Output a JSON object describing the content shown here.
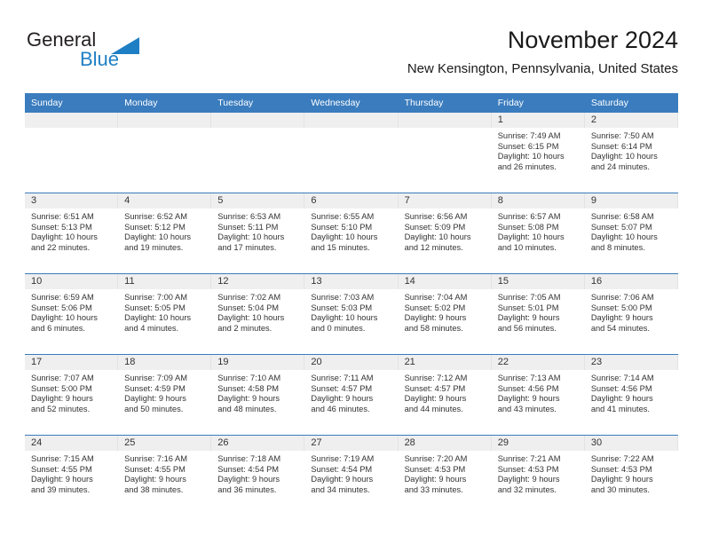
{
  "brand": {
    "name_top": "General",
    "name_bottom": "Blue",
    "triangle_color": "#1f7fc4",
    "text_color": "#231f20",
    "blue_color": "#1f7fc4"
  },
  "header": {
    "title": "November 2024",
    "subtitle": "New Kensington, Pennsylvania, United States"
  },
  "theme": {
    "header_blue": "#3a7cbe",
    "daynum_band": "#efefef",
    "text": "#333333"
  },
  "weekdays": [
    "Sunday",
    "Monday",
    "Tuesday",
    "Wednesday",
    "Thursday",
    "Friday",
    "Saturday"
  ],
  "labels": {
    "sunrise_prefix": "Sunrise:",
    "sunset_prefix": "Sunset:",
    "daylight_prefix": "Daylight:"
  },
  "weeks": [
    [
      {
        "day": "",
        "empty": true
      },
      {
        "day": "",
        "empty": true
      },
      {
        "day": "",
        "empty": true
      },
      {
        "day": "",
        "empty": true
      },
      {
        "day": "",
        "empty": true
      },
      {
        "day": "1",
        "sunrise": "Sunrise: 7:49 AM",
        "sunset": "Sunset: 6:15 PM",
        "daylight_line1": "Daylight: 10 hours",
        "daylight_line2": "and 26 minutes."
      },
      {
        "day": "2",
        "sunrise": "Sunrise: 7:50 AM",
        "sunset": "Sunset: 6:14 PM",
        "daylight_line1": "Daylight: 10 hours",
        "daylight_line2": "and 24 minutes."
      }
    ],
    [
      {
        "day": "3",
        "sunrise": "Sunrise: 6:51 AM",
        "sunset": "Sunset: 5:13 PM",
        "daylight_line1": "Daylight: 10 hours",
        "daylight_line2": "and 22 minutes."
      },
      {
        "day": "4",
        "sunrise": "Sunrise: 6:52 AM",
        "sunset": "Sunset: 5:12 PM",
        "daylight_line1": "Daylight: 10 hours",
        "daylight_line2": "and 19 minutes."
      },
      {
        "day": "5",
        "sunrise": "Sunrise: 6:53 AM",
        "sunset": "Sunset: 5:11 PM",
        "daylight_line1": "Daylight: 10 hours",
        "daylight_line2": "and 17 minutes."
      },
      {
        "day": "6",
        "sunrise": "Sunrise: 6:55 AM",
        "sunset": "Sunset: 5:10 PM",
        "daylight_line1": "Daylight: 10 hours",
        "daylight_line2": "and 15 minutes."
      },
      {
        "day": "7",
        "sunrise": "Sunrise: 6:56 AM",
        "sunset": "Sunset: 5:09 PM",
        "daylight_line1": "Daylight: 10 hours",
        "daylight_line2": "and 12 minutes."
      },
      {
        "day": "8",
        "sunrise": "Sunrise: 6:57 AM",
        "sunset": "Sunset: 5:08 PM",
        "daylight_line1": "Daylight: 10 hours",
        "daylight_line2": "and 10 minutes."
      },
      {
        "day": "9",
        "sunrise": "Sunrise: 6:58 AM",
        "sunset": "Sunset: 5:07 PM",
        "daylight_line1": "Daylight: 10 hours",
        "daylight_line2": "and 8 minutes."
      }
    ],
    [
      {
        "day": "10",
        "sunrise": "Sunrise: 6:59 AM",
        "sunset": "Sunset: 5:06 PM",
        "daylight_line1": "Daylight: 10 hours",
        "daylight_line2": "and 6 minutes."
      },
      {
        "day": "11",
        "sunrise": "Sunrise: 7:00 AM",
        "sunset": "Sunset: 5:05 PM",
        "daylight_line1": "Daylight: 10 hours",
        "daylight_line2": "and 4 minutes."
      },
      {
        "day": "12",
        "sunrise": "Sunrise: 7:02 AM",
        "sunset": "Sunset: 5:04 PM",
        "daylight_line1": "Daylight: 10 hours",
        "daylight_line2": "and 2 minutes."
      },
      {
        "day": "13",
        "sunrise": "Sunrise: 7:03 AM",
        "sunset": "Sunset: 5:03 PM",
        "daylight_line1": "Daylight: 10 hours",
        "daylight_line2": "and 0 minutes."
      },
      {
        "day": "14",
        "sunrise": "Sunrise: 7:04 AM",
        "sunset": "Sunset: 5:02 PM",
        "daylight_line1": "Daylight: 9 hours",
        "daylight_line2": "and 58 minutes."
      },
      {
        "day": "15",
        "sunrise": "Sunrise: 7:05 AM",
        "sunset": "Sunset: 5:01 PM",
        "daylight_line1": "Daylight: 9 hours",
        "daylight_line2": "and 56 minutes."
      },
      {
        "day": "16",
        "sunrise": "Sunrise: 7:06 AM",
        "sunset": "Sunset: 5:00 PM",
        "daylight_line1": "Daylight: 9 hours",
        "daylight_line2": "and 54 minutes."
      }
    ],
    [
      {
        "day": "17",
        "sunrise": "Sunrise: 7:07 AM",
        "sunset": "Sunset: 5:00 PM",
        "daylight_line1": "Daylight: 9 hours",
        "daylight_line2": "and 52 minutes."
      },
      {
        "day": "18",
        "sunrise": "Sunrise: 7:09 AM",
        "sunset": "Sunset: 4:59 PM",
        "daylight_line1": "Daylight: 9 hours",
        "daylight_line2": "and 50 minutes."
      },
      {
        "day": "19",
        "sunrise": "Sunrise: 7:10 AM",
        "sunset": "Sunset: 4:58 PM",
        "daylight_line1": "Daylight: 9 hours",
        "daylight_line2": "and 48 minutes."
      },
      {
        "day": "20",
        "sunrise": "Sunrise: 7:11 AM",
        "sunset": "Sunset: 4:57 PM",
        "daylight_line1": "Daylight: 9 hours",
        "daylight_line2": "and 46 minutes."
      },
      {
        "day": "21",
        "sunrise": "Sunrise: 7:12 AM",
        "sunset": "Sunset: 4:57 PM",
        "daylight_line1": "Daylight: 9 hours",
        "daylight_line2": "and 44 minutes."
      },
      {
        "day": "22",
        "sunrise": "Sunrise: 7:13 AM",
        "sunset": "Sunset: 4:56 PM",
        "daylight_line1": "Daylight: 9 hours",
        "daylight_line2": "and 43 minutes."
      },
      {
        "day": "23",
        "sunrise": "Sunrise: 7:14 AM",
        "sunset": "Sunset: 4:56 PM",
        "daylight_line1": "Daylight: 9 hours",
        "daylight_line2": "and 41 minutes."
      }
    ],
    [
      {
        "day": "24",
        "sunrise": "Sunrise: 7:15 AM",
        "sunset": "Sunset: 4:55 PM",
        "daylight_line1": "Daylight: 9 hours",
        "daylight_line2": "and 39 minutes."
      },
      {
        "day": "25",
        "sunrise": "Sunrise: 7:16 AM",
        "sunset": "Sunset: 4:55 PM",
        "daylight_line1": "Daylight: 9 hours",
        "daylight_line2": "and 38 minutes."
      },
      {
        "day": "26",
        "sunrise": "Sunrise: 7:18 AM",
        "sunset": "Sunset: 4:54 PM",
        "daylight_line1": "Daylight: 9 hours",
        "daylight_line2": "and 36 minutes."
      },
      {
        "day": "27",
        "sunrise": "Sunrise: 7:19 AM",
        "sunset": "Sunset: 4:54 PM",
        "daylight_line1": "Daylight: 9 hours",
        "daylight_line2": "and 34 minutes."
      },
      {
        "day": "28",
        "sunrise": "Sunrise: 7:20 AM",
        "sunset": "Sunset: 4:53 PM",
        "daylight_line1": "Daylight: 9 hours",
        "daylight_line2": "and 33 minutes."
      },
      {
        "day": "29",
        "sunrise": "Sunrise: 7:21 AM",
        "sunset": "Sunset: 4:53 PM",
        "daylight_line1": "Daylight: 9 hours",
        "daylight_line2": "and 32 minutes."
      },
      {
        "day": "30",
        "sunrise": "Sunrise: 7:22 AM",
        "sunset": "Sunset: 4:53 PM",
        "daylight_line1": "Daylight: 9 hours",
        "daylight_line2": "and 30 minutes."
      }
    ]
  ]
}
